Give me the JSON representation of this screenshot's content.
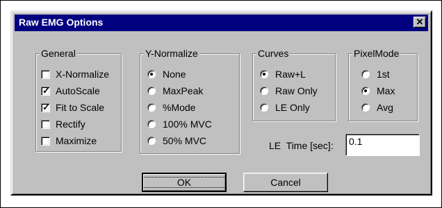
{
  "dialog": {
    "title": "Raw EMG Options",
    "close_glyph": "✕"
  },
  "general": {
    "label": "General",
    "items": [
      {
        "label": "X-Normalize",
        "checked": false
      },
      {
        "label": "AutoScale",
        "checked": true
      },
      {
        "label": "Fit to Scale",
        "checked": true
      },
      {
        "label": "Rectify",
        "checked": false
      },
      {
        "label": "Maximize",
        "checked": false
      }
    ]
  },
  "ynormalize": {
    "label": "Y-Normalize",
    "options": [
      "None",
      "MaxPeak",
      "%Mode",
      "100% MVC",
      "50% MVC"
    ],
    "selected": "None"
  },
  "curves": {
    "label": "Curves",
    "options": [
      "Raw+L",
      "Raw Only",
      "LE Only"
    ],
    "selected": "Raw+L"
  },
  "pixelmode": {
    "label": "PixelMode",
    "options": [
      "1st",
      "Max",
      "Avg"
    ],
    "selected": "Max"
  },
  "le_time": {
    "label": "LE  Time [sec]:",
    "value": "0.1"
  },
  "buttons": {
    "ok": "OK",
    "cancel": "Cancel"
  }
}
